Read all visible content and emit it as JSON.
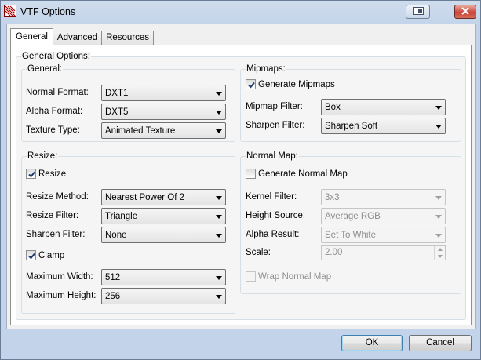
{
  "window": {
    "title": "VTF Options"
  },
  "tabs": [
    {
      "label": "General",
      "active": true
    },
    {
      "label": "Advanced",
      "active": false
    },
    {
      "label": "Resources",
      "active": false
    }
  ],
  "general_options": {
    "legend": "General Options:",
    "general": {
      "legend": "General:",
      "normal_format": {
        "label": "Normal Format:",
        "value": "DXT1"
      },
      "alpha_format": {
        "label": "Alpha Format:",
        "value": "DXT5"
      },
      "texture_type": {
        "label": "Texture Type:",
        "value": "Animated Texture"
      }
    },
    "mipmaps": {
      "legend": "Mipmaps:",
      "generate": {
        "label": "Generate Mipmaps",
        "checked": true
      },
      "filter": {
        "label": "Mipmap Filter:",
        "value": "Box"
      },
      "sharpen": {
        "label": "Sharpen Filter:",
        "value": "Sharpen Soft"
      }
    },
    "resize": {
      "legend": "Resize:",
      "resize": {
        "label": "Resize",
        "checked": true
      },
      "method": {
        "label": "Resize Method:",
        "value": "Nearest Power Of 2"
      },
      "filter": {
        "label": "Resize Filter:",
        "value": "Triangle"
      },
      "sharpen": {
        "label": "Sharpen Filter:",
        "value": "None"
      },
      "clamp": {
        "label": "Clamp",
        "checked": true
      },
      "max_width": {
        "label": "Maximum Width:",
        "value": "512"
      },
      "max_height": {
        "label": "Maximum Height:",
        "value": "256"
      }
    },
    "normal_map": {
      "legend": "Normal Map:",
      "generate": {
        "label": "Generate Normal Map",
        "checked": false
      },
      "kernel": {
        "label": "Kernel Filter:",
        "value": "3x3"
      },
      "height_source": {
        "label": "Height Source:",
        "value": "Average RGB"
      },
      "alpha_result": {
        "label": "Alpha Result:",
        "value": "Set To White"
      },
      "scale": {
        "label": "Scale:",
        "value": "2.00"
      },
      "wrap": {
        "label": "Wrap Normal Map",
        "checked": false
      }
    }
  },
  "buttons": {
    "ok": "OK",
    "cancel": "Cancel"
  },
  "colors": {
    "title_bar": "#c9d9ee",
    "close_button": "#c7453a",
    "default_button_border": "#3c7fb1"
  }
}
